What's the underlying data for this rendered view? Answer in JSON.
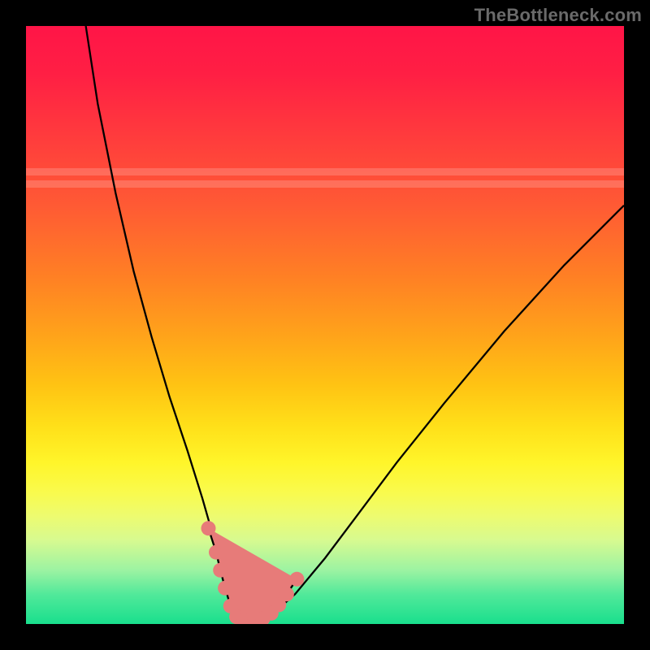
{
  "watermark": "TheBottleneck.com",
  "chart_data": {
    "type": "line",
    "title": "",
    "xlabel": "",
    "ylabel": "",
    "xlim": [
      0,
      100
    ],
    "ylim": [
      0,
      100
    ],
    "grid": false,
    "curve": {
      "x": [
        10,
        12,
        15,
        18,
        21,
        24,
        27,
        29.5,
        31.5,
        33,
        34.3,
        36,
        38.5,
        41,
        45,
        50,
        56,
        62,
        70,
        80,
        90,
        100
      ],
      "y_pct": [
        100,
        87,
        72,
        59,
        48,
        38,
        29,
        21,
        14,
        8,
        3,
        0.5,
        0.5,
        1.5,
        5,
        11,
        19,
        27,
        37,
        49,
        60,
        70
      ]
    },
    "markers": [
      {
        "x": 30.5,
        "y_pct": 16
      },
      {
        "x": 31.8,
        "y_pct": 12
      },
      {
        "x": 32.5,
        "y_pct": 9
      },
      {
        "x": 33.3,
        "y_pct": 6
      },
      {
        "x": 34.2,
        "y_pct": 3
      },
      {
        "x": 35.2,
        "y_pct": 1.2
      },
      {
        "x": 36.5,
        "y_pct": 0.6
      },
      {
        "x": 38.2,
        "y_pct": 0.6
      },
      {
        "x": 39.6,
        "y_pct": 0.9
      },
      {
        "x": 41.0,
        "y_pct": 1.8
      },
      {
        "x": 42.3,
        "y_pct": 3.2
      },
      {
        "x": 43.6,
        "y_pct": 5.0
      },
      {
        "x": 45.3,
        "y_pct": 7.5
      }
    ],
    "pale_bands_y_pct": [
      {
        "from": 73,
        "to": 74.2
      },
      {
        "from": 75.0,
        "to": 76.2
      }
    ]
  }
}
